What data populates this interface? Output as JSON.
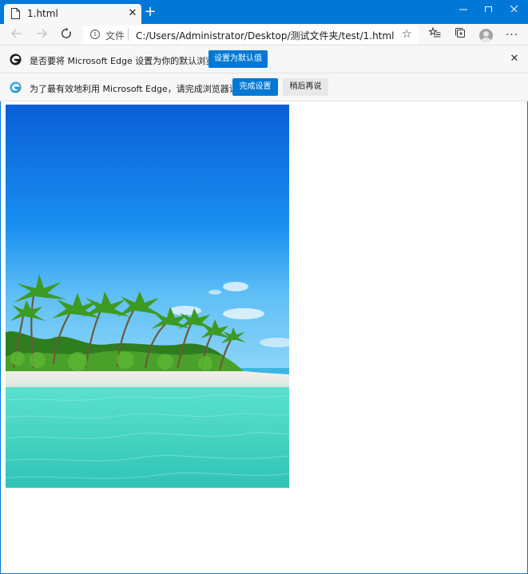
{
  "tab": {
    "title": "1.html",
    "close_icon": "close-icon"
  },
  "window": {
    "accent": "#0078d7"
  },
  "toolbar": {
    "scheme_label": "文件",
    "url": "C:/Users/Administrator/Desktop/测试文件夹/test/1.html"
  },
  "infobar_default": {
    "message": "是否要将 Microsoft Edge 设置为你的默认浏览器?",
    "set_default_label": "设置为默认值"
  },
  "infobar_setup": {
    "message": "为了最有效地利用 Microsoft Edge，请完成浏览器设置。",
    "finish_label": "完成设置",
    "later_label": "稍后再说"
  },
  "colors": {
    "primary_button": "#0078d4",
    "sky_top": "#0a5fd6",
    "sea": "#48d9c4"
  }
}
